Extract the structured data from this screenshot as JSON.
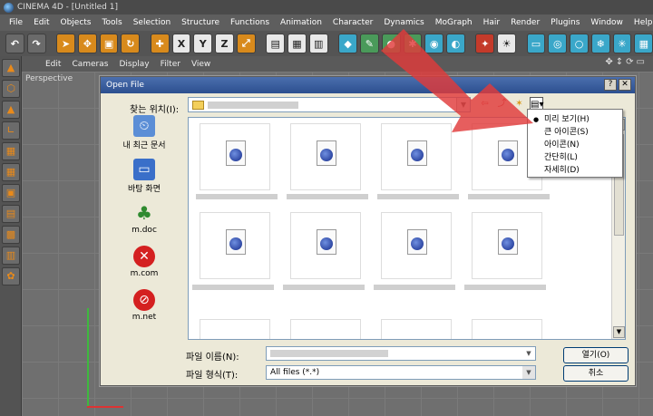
{
  "app": {
    "title": "CINEMA 4D - [Untitled 1]"
  },
  "menu": [
    "File",
    "Edit",
    "Objects",
    "Tools",
    "Selection",
    "Structure",
    "Functions",
    "Animation",
    "Character",
    "Dynamics",
    "MoGraph",
    "Hair",
    "Render",
    "Plugins",
    "Window",
    "Help"
  ],
  "viewport": {
    "menu": [
      "Edit",
      "Cameras",
      "Display",
      "Filter",
      "View"
    ],
    "label": "Perspective"
  },
  "dialog": {
    "title": "Open File",
    "look_in_label": "찾는 위치(I):",
    "places": [
      {
        "label": "내 최근 문서",
        "icon": "recent-docs-icon"
      },
      {
        "label": "바탕 화면",
        "icon": "desktop-icon"
      },
      {
        "label": "m.doc",
        "icon": "tree-icon"
      },
      {
        "label": "m.com",
        "icon": "error-icon"
      },
      {
        "label": "m.net",
        "icon": "no-entry-icon"
      }
    ],
    "view_menu": [
      {
        "label": "미리 보기(H)",
        "selected": true
      },
      {
        "label": "큰 아이콘(S)",
        "selected": false
      },
      {
        "label": "아이콘(N)",
        "selected": false
      },
      {
        "label": "간단히(L)",
        "selected": false
      },
      {
        "label": "자세히(D)",
        "selected": false
      }
    ],
    "file_name_label": "파일 이름(N):",
    "file_type_label": "파일 형식(T):",
    "file_type_value": "All files (*.*)",
    "open_button": "열기(O)",
    "cancel_button": "취소"
  },
  "colors": {
    "accent_arrow": "#e03a3a",
    "title_bar": "#2c4f8f"
  }
}
